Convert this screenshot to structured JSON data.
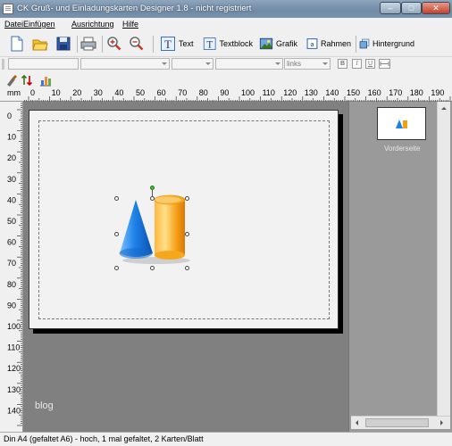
{
  "window": {
    "title": "CK Gruß- und Einladungskarten Designer 1.8 - nicht registriert"
  },
  "menu": [
    "Datei",
    "Einfügen",
    "Ausrichtung",
    "Hilfe"
  ],
  "toolbar": {
    "text_label": "Text",
    "textblock_label": "Textblock",
    "grafik_label": "Grafik",
    "rahmen_label": "Rahmen",
    "hintergrund_label": "Hintergrund"
  },
  "format": {
    "align_value": "links",
    "bold": "B",
    "italic": "I",
    "underline": "U"
  },
  "ruler": {
    "unit": "mm",
    "h": [
      "0",
      "10",
      "20",
      "30",
      "40",
      "50",
      "60",
      "70",
      "80",
      "90",
      "100",
      "110",
      "120",
      "130",
      "140",
      "150",
      "160",
      "170",
      "180",
      "190",
      "20"
    ],
    "v": [
      "0",
      "10",
      "20",
      "30",
      "40",
      "50",
      "60",
      "70",
      "80",
      "90",
      "100",
      "110",
      "120",
      "130",
      "140"
    ]
  },
  "canvas": {
    "watermark": "blog"
  },
  "pages_panel": {
    "thumb_label": "Vorderseite"
  },
  "status": {
    "text": "Din A4 (gefaltet A6) - hoch, 1 mal gefaltet, 2 Karten/Blatt"
  },
  "colors": {
    "titlebar": "#7b93ac",
    "canvas_bg": "#808080",
    "cone": "#2b7fe0",
    "cylinder": "#f39a12"
  }
}
